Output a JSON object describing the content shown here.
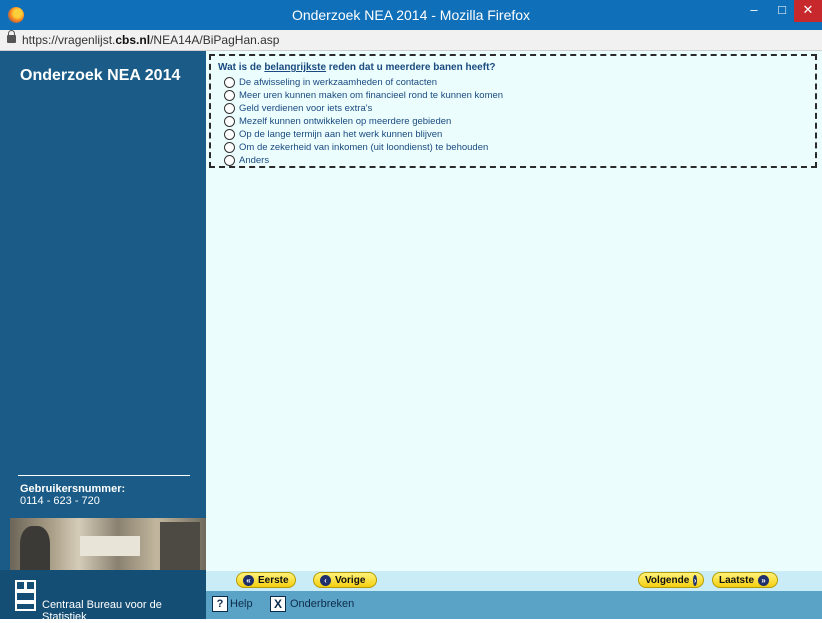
{
  "window": {
    "title": "Onderzoek NEA 2014 - Mozilla Firefox",
    "minimize": "–",
    "maximize": "□",
    "close": "✕"
  },
  "address": {
    "prefix": "https://vragenlijst.",
    "domain": "cbs.nl",
    "path": "/NEA14A/BiPagHan.asp"
  },
  "sidebar": {
    "title": "Onderzoek NEA 2014",
    "user_label": "Gebruikersnummer:",
    "user_number": "0114 - 623 - 720",
    "org_name": "Centraal Bureau voor de Statistiek"
  },
  "question": {
    "text_before": "Wat is de ",
    "text_emph": "belangrijkste",
    "text_after": " reden dat u meerdere banen heeft?",
    "options": [
      "De afwisseling in werkzaamheden of contacten",
      "Meer uren kunnen maken om financieel rond te kunnen komen",
      "Geld verdienen voor iets extra's",
      "Mezelf kunnen ontwikkelen op meerdere gebieden",
      "Op de lange termijn aan het werk kunnen blijven",
      "Om de zekerheid van inkomen (uit loondienst) te behouden",
      "Anders"
    ]
  },
  "nav": {
    "first": "Eerste",
    "previous": "Vorige",
    "next": "Volgende",
    "last": "Laatste",
    "first_icon": "«",
    "previous_icon": "‹",
    "next_icon": "›",
    "last_icon": "»"
  },
  "footer": {
    "help": "Help",
    "help_icon": "?",
    "abort": "Onderbreken",
    "abort_icon": "X"
  },
  "icons": {
    "browser": "firefox-icon",
    "lock": "lock-icon",
    "logo": "cbs-logo"
  },
  "colors": {
    "titlebar": "#0f6fb8",
    "sidebar": "#1a5c87",
    "content_bg": "#ebfdfd",
    "nav_button": "#f4cf10",
    "footer_bar": "#5aa3c7"
  }
}
